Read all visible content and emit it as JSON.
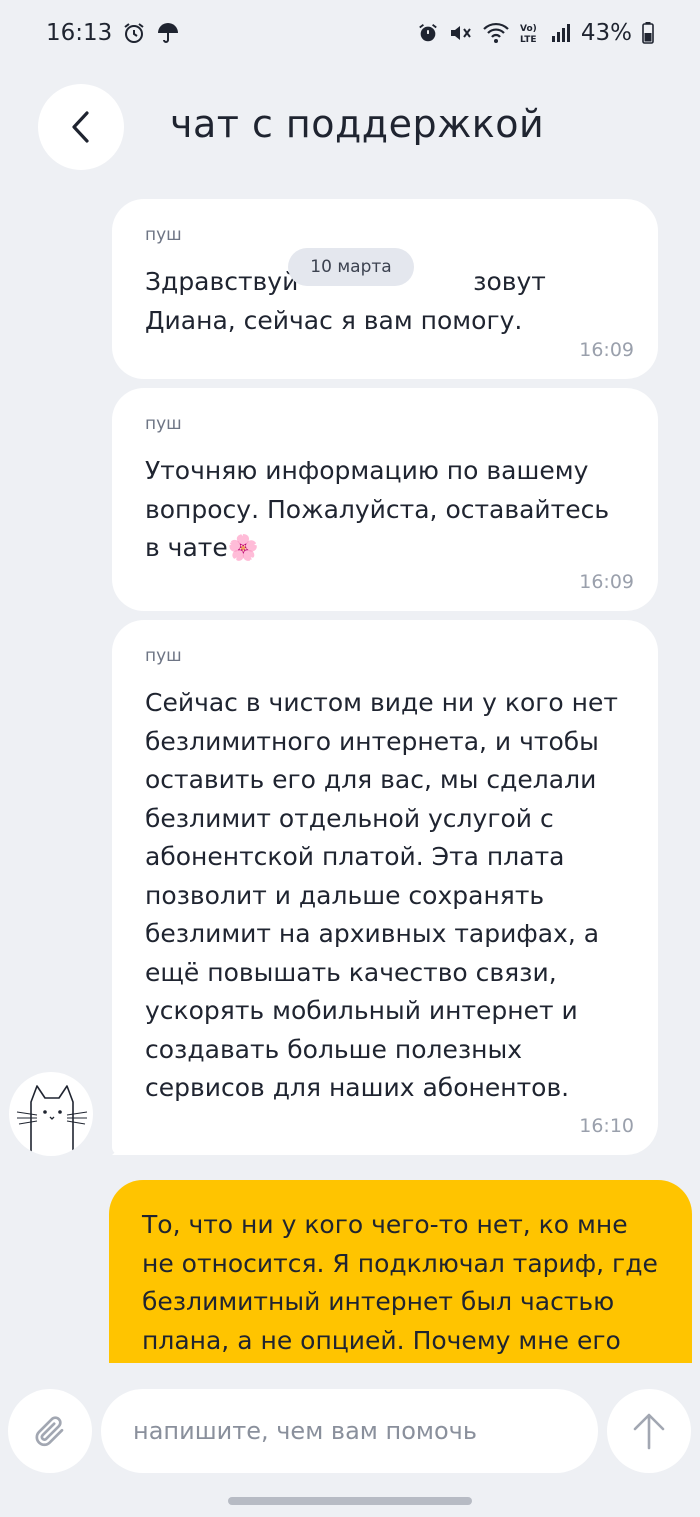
{
  "status_bar": {
    "time": "16:13",
    "battery": "43%",
    "left_icons": [
      "alarm-icon",
      "umbrella-icon"
    ],
    "right_icons": [
      "alarm-icon",
      "mute-icon",
      "wifi-icon",
      "volte-icon",
      "signal-icon",
      "battery-icon"
    ]
  },
  "header": {
    "title": "чат с поддержкой"
  },
  "date_pill": "10 марта",
  "messages": [
    {
      "sender": "пуш",
      "text": "Здравствуй                      зовут Диана, сейчас я вам помогу.",
      "time": "16:09"
    },
    {
      "sender": "пуш",
      "text": "Уточняю информацию по вашему вопросу. Пожалуйста, оставайтесь в чате🌸",
      "time": "16:09"
    },
    {
      "sender": "пуш",
      "text": "Сейчас в чистом виде ни у кого нет безлимитного интернета, и чтобы оставить его для вас, мы сделали безлимит отдельной услугой с абонентской платой. Эта плата позволит и дальше сохранять безлимит на архивных тарифах, а ещё повышать качество связи, ускорять мобильный интернет и создавать больше полезных сервисов для наших абонентов.",
      "time": "16:10"
    }
  ],
  "outgoing": {
    "text": "То, что ни у кого чего-то нет, ко мне не относится. Я подключал тариф, где безлимитный интернет был частью плана, а не опцией. Почему мне его"
  },
  "input": {
    "placeholder": "напишите, чем вам помочь",
    "value": ""
  },
  "colors": {
    "background": "#eef0f4",
    "bubble": "#ffffff",
    "outgoing": "#ffc400",
    "text": "#1f2430",
    "muted": "#9aa0ac"
  }
}
